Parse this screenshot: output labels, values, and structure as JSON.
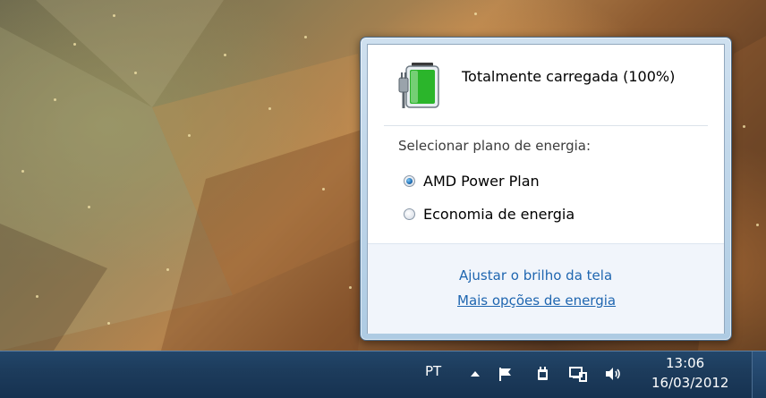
{
  "power_flyout": {
    "battery_status": "Totalmente carregada (100%)",
    "plan_section_label": "Selecionar plano de energia:",
    "plans": [
      {
        "label": "AMD Power Plan",
        "selected": true
      },
      {
        "label": "Economia de energia",
        "selected": false
      }
    ],
    "links": {
      "brightness": "Ajustar o brilho da tela",
      "more_options": "Mais opções de energia"
    }
  },
  "taskbar": {
    "language": "PT",
    "time": "13:06",
    "date": "16/03/2012",
    "tray_icons": [
      "action-center-flag-icon",
      "power-plug-icon",
      "network-icon",
      "volume-icon"
    ]
  },
  "colors": {
    "link": "#1f66b0",
    "taskbar": "#1d3c5c",
    "battery_green": "#2bb52b"
  }
}
